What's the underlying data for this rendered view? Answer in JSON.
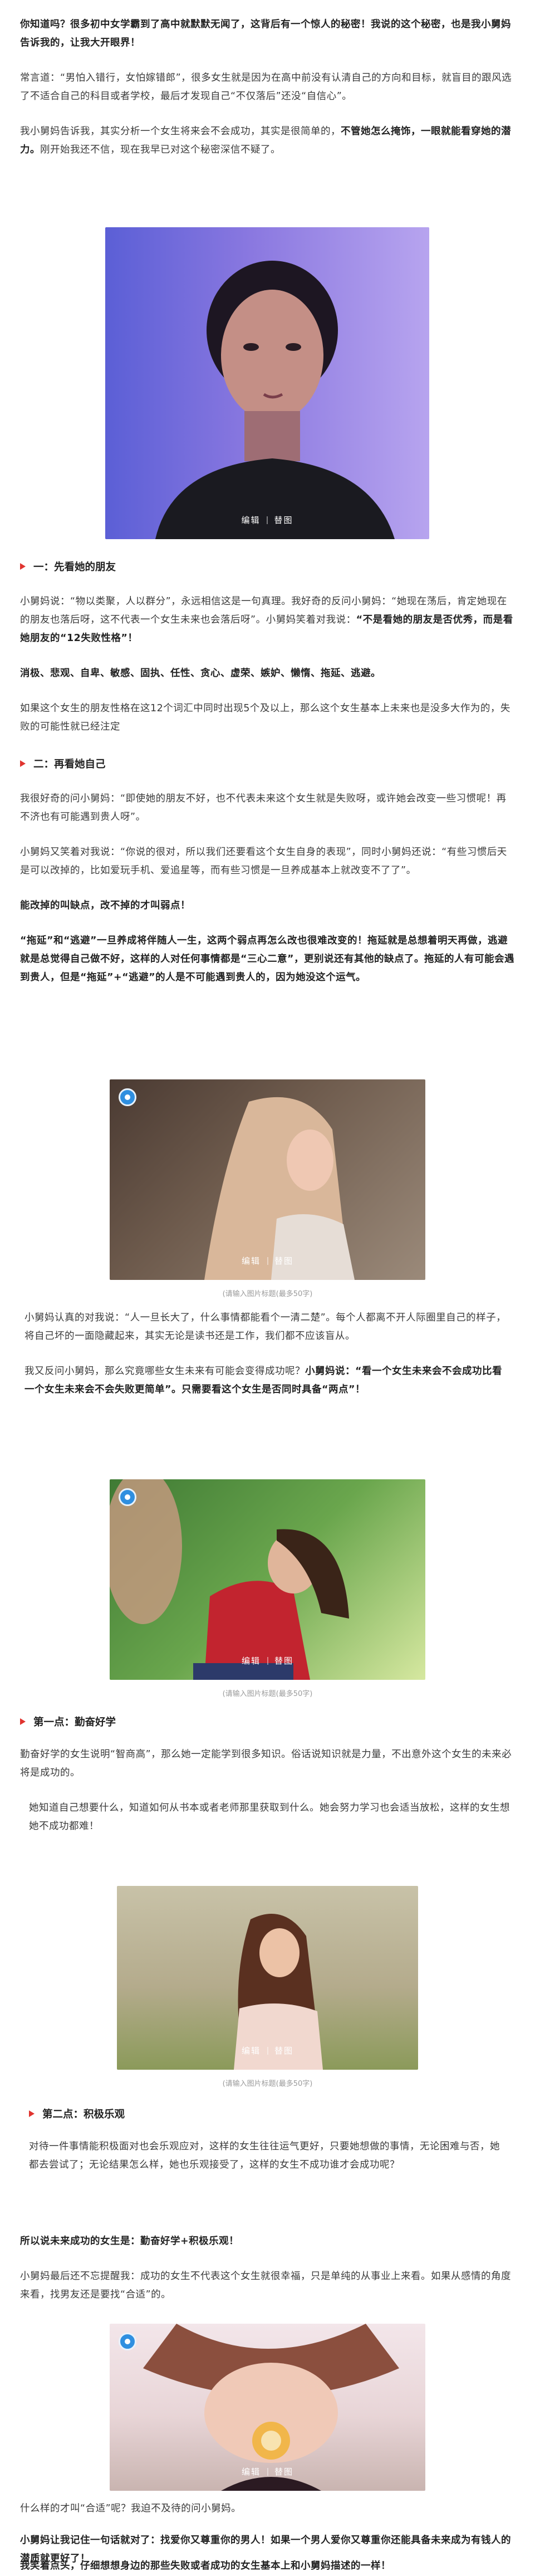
{
  "intro": {
    "p1_bold": "你知道吗？很多初中女学霸到了高中就默默无闻了，这背后有一个惊人的秘密！我说的这个秘密，也是我小舅妈告诉我的，让我大开眼界！",
    "p2": "常言道：“男怕入错行，女怕嫁错郎”，很多女生就是因为在高中前没有认清自己的方向和目标，就盲目的跟风选了不适合自己的科目或者学校，最后才发现自己“不仅落后”还没“自信心”。",
    "p3_a": "我小舅妈告诉我，其实分析一个女生将来会不会成功，其实是很简单的，",
    "p3_b": "不管她怎么掩饰，一眼就能看穿她的潜力。",
    "p3_c": "刚开始我还不信，现在我早已对这个秘密深信不疑了。"
  },
  "image_overlay": {
    "edit": "编辑",
    "image": "替图"
  },
  "section1": {
    "heading": "一：先看她的朋友",
    "p1_a": "小舅妈说：“物以类聚，人以群分”，永远相信这是一句真理。我好奇的反问小舅妈：“她现在荡后，肯定她现在的朋友也落后呀，这不代表一个女生未来也会落后呀”。小舅妈笑着对我说：",
    "p1_b": "“不是看她的朋友是否优秀，而是看她朋友的“12失败性格”！",
    "p2_bold": "消极、悲观、自卑、敏感、固执、任性、贪心、虚荣、嫉妒、懒惰、拖延、逃避。",
    "p3": "如果这个女生的朋友性格在这12个词汇中同时出现5个及以上，那么这个女生基本上未来也是没多大作为的，失败的可能性就已经注定"
  },
  "section2": {
    "heading": "二：再看她自己",
    "p1": "我很好奇的问小舅妈：“即使她的朋友不好，也不代表未来这个女生就是失败呀，或许她会改变一些习惯呢！再不济也有可能遇到贵人呀”。",
    "p2": "小舅妈又笑着对我说：“你说的很对，所以我们还要看这个女生自身的表现”，同时小舅妈还说：“有些习惯后天是可以改掉的，比如爱玩手机、爱追星等，而有些习惯是一旦养成基本上就改变不了了”。",
    "p3_bold": "能改掉的叫缺点，改不掉的才叫弱点！",
    "p4_bold": "“拖延”和“逃避”一旦养成将伴随人一生，这两个弱点再怎么改也很难改变的！拖延就是总想着明天再做，逃避就是总觉得自己做不好，这样的人对任何事情都是“三心二意”，更别说还有其他的缺点了。拖延的人有可能会遇到贵人，但是“拖延”+“逃避”的人是不可能遇到贵人的，因为她没这个运气。"
  },
  "caption": "(请输入图片标题(最多50字)",
  "section2b": {
    "p1_a": "小舅妈认真的对我说：“人一旦长大了，什么事情都能看个一清二楚”。",
    "p1_b": "每个人都离不开人际圈里自己的样子，将自己坏的一面隐藏起来，其实无论是读书还是工作，我们都不应该盲从。",
    "p2_a": "我又反问小舅妈，那么究竟哪些女生未来有可能会变得成功呢？",
    "p2_b": "小舅妈说：“看一个女生未来会不会成功比看一个女生未来会不会失败更简单”。只需要看这个女生是否同时具备“两点”！"
  },
  "point1": {
    "heading": "第一点：勤奋好学",
    "p1": "勤奋好学的女生说明“智商高”，那么她一定能学到很多知识。俗话说知识就是力量，不出意外这个女生的未来必将是成功的。",
    "p2": "她知道自己想要什么，知道如何从书本或者老师那里获取到什么。她会努力学习也会适当放松，这样的女生想她不成功都难！"
  },
  "point2": {
    "heading": "第二点：积极乐观",
    "p1": "对待一件事情能积极面对也会乐观应对，这样的女生往往运气更好，只要她想做的事情，无论困难与否，她都去尝试了；无论结果怎么样，她也乐观接受了，这样的女生不成功谁才会成功呢？"
  },
  "summary": {
    "bold": "所以说未来成功的女生是：勤奋好学+积极乐观！",
    "p1": "小舅妈最后还不忘提醒我：成功的女生不代表这个女生就很幸福，只是单纯的从事业上来看。如果从感情的角度来看，找男友还是要找“合适”的。",
    "p2": "什么样的才叫“合适”呢？我迫不及待的问小舅妈。",
    "p3_bold": "小舅妈让我记住一句话就对了：找爱你又尊重你的男人！如果一个男人爱你又尊重你还能具备未来成为有钱人的潜质就更好了！",
    "p4_bold": "我笑着点头，仔细想想身边的那些失败或者成功的女生基本上和小舅妈描述的一样！"
  },
  "colors": {
    "accent": "#e0342f",
    "badge": "#2f8fe0",
    "text": "#3a3a3a"
  }
}
